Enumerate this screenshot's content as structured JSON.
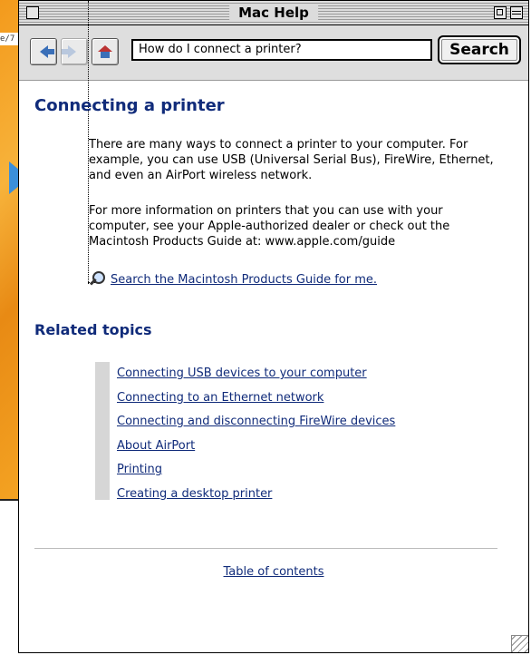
{
  "bg_window": {
    "url_fragment": "e/7"
  },
  "window": {
    "title": "Mac Help"
  },
  "toolbar": {
    "back_icon": "left-arrow-icon",
    "forward_icon": "right-arrow-icon",
    "home_icon": "home-icon",
    "search_value": "How do I connect a printer?",
    "search_label": "Search"
  },
  "article": {
    "title": "Connecting a printer",
    "para1": "There are many ways to connect a printer to your computer. For example, you can use USB (Universal Serial Bus), FireWire, Ethernet, and even an AirPort wireless network.",
    "para2": "For more information on printers that you can use with your computer, see your Apple-authorized dealer or check out the Macintosh Products Guide at: www.apple.com/guide",
    "lookup_link": "Search the Macintosh Products Guide for me."
  },
  "related": {
    "heading": "Related topics",
    "items": [
      "Connecting USB devices to your computer",
      "Connecting to an Ethernet network",
      "Connecting and disconnecting FireWire devices",
      "About AirPort",
      "Printing",
      "Creating a desktop printer"
    ]
  },
  "footer": {
    "toc": "Table of contents"
  },
  "colors": {
    "heading": "#102b7a",
    "bg_accent": "#f39a1c"
  }
}
